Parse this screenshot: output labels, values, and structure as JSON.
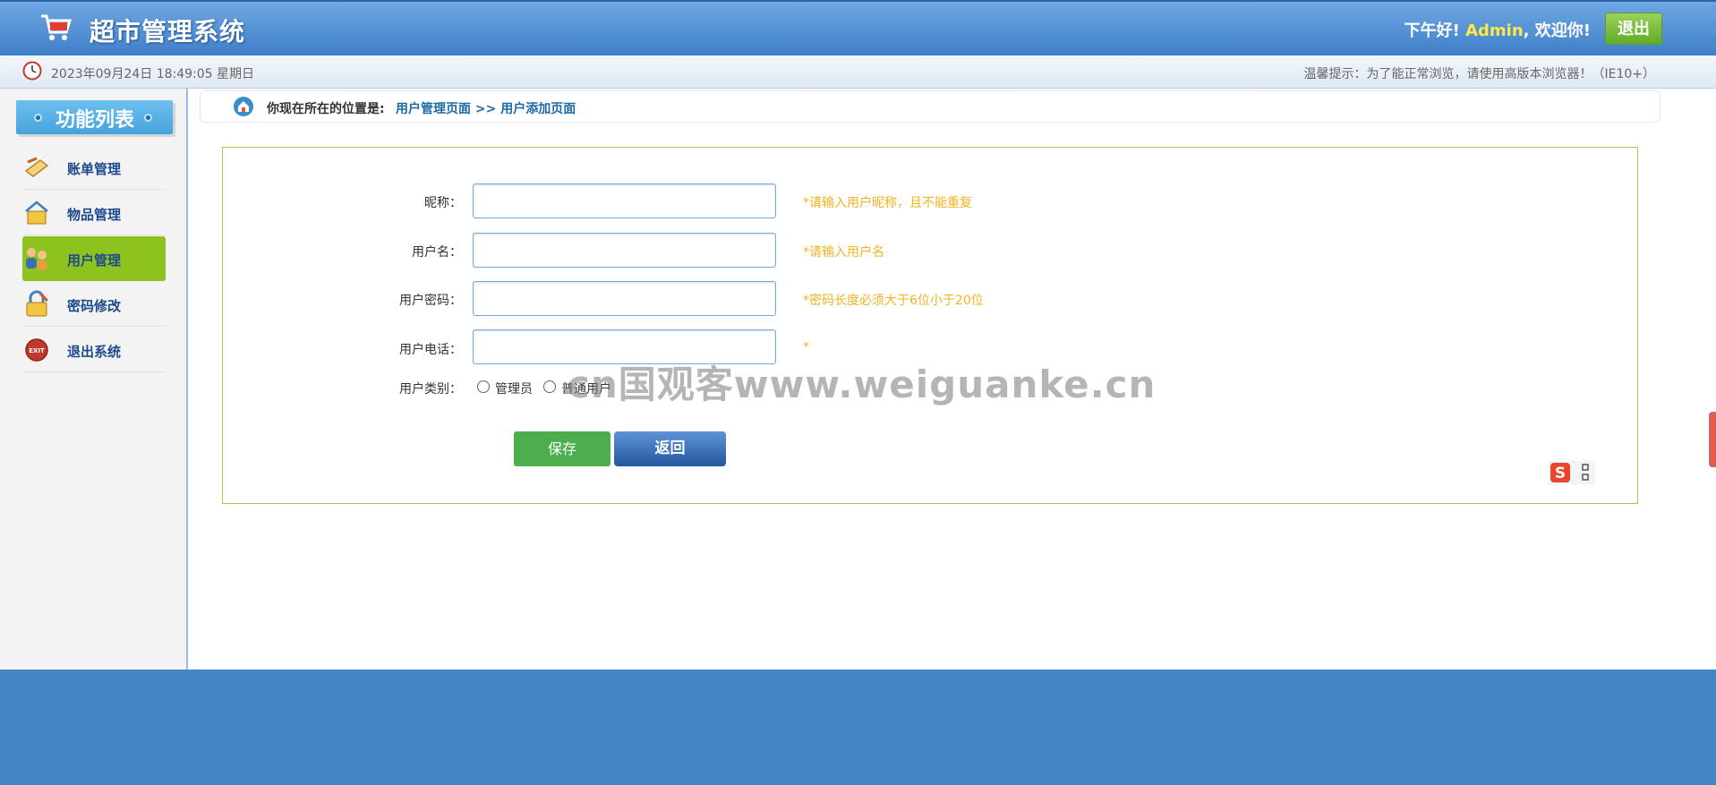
{
  "header": {
    "title": "超市管理系统",
    "greeting_prefix": "下午好!",
    "user": "Admin",
    "greeting_suffix": ", 欢迎你!",
    "logout_label": "退出"
  },
  "infobar": {
    "datetime": "2023年09月24日 18:49:05 星期日",
    "tip": "温馨提示：为了能正常浏览，请使用高版本浏览器！（IE10+）"
  },
  "sidebar": {
    "heading": "功能列表",
    "items": [
      {
        "label": "账单管理",
        "icon": "bill-icon"
      },
      {
        "label": "物品管理",
        "icon": "goods-icon"
      },
      {
        "label": "用户管理",
        "icon": "users-icon",
        "active": true
      },
      {
        "label": "密码修改",
        "icon": "lock-icon"
      },
      {
        "label": "退出系统",
        "icon": "exit-icon"
      }
    ]
  },
  "breadcrumb": {
    "prefix": "你现在所在的位置是:",
    "path": "用户管理页面 >> 用户添加页面"
  },
  "form": {
    "nickname": {
      "label": "昵称：",
      "value": "",
      "hint": "*请输入用户昵称，且不能重复"
    },
    "username": {
      "label": "用户名：",
      "value": "",
      "hint": "*请输入用户名"
    },
    "password": {
      "label": "用户密码：",
      "value": "",
      "hint": "*密码长度必须大于6位小于20位"
    },
    "phone": {
      "label": "用户电话：",
      "value": "",
      "hint": "*"
    },
    "role": {
      "label": "用户类别：",
      "options": [
        "管理员",
        "普通用户"
      ]
    },
    "save_label": "保存",
    "back_label": "返回"
  },
  "watermark": "cn国观客www.weiguanke.cn",
  "colors": {
    "header_blue": "#4a8bd4",
    "active_green": "#8dc21f",
    "hint_orange": "#f2b321",
    "footer_blue": "#4286c5"
  }
}
